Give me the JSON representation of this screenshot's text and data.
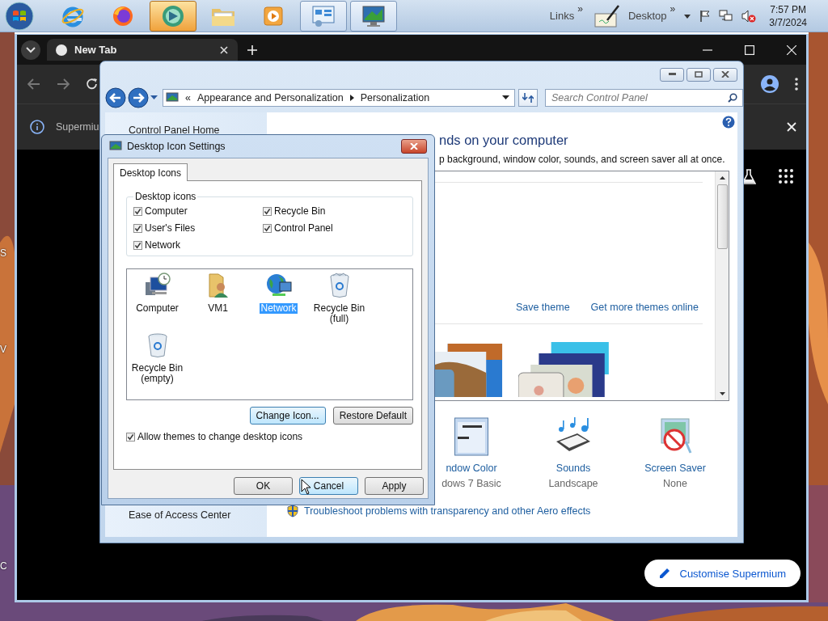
{
  "desktop": {
    "kind": "picture",
    "edge_labels": [
      "S",
      "V",
      "C"
    ]
  },
  "taskbar": {
    "apps": [
      {
        "kind": "ie",
        "selected": false,
        "running": false
      },
      {
        "kind": "firefox",
        "selected": false,
        "running": false
      },
      {
        "kind": "green-app",
        "selected": true,
        "running": false
      },
      {
        "kind": "folder",
        "selected": false,
        "running": false
      },
      {
        "kind": "media",
        "selected": false,
        "running": false
      },
      {
        "kind": "control-panel",
        "selected": false,
        "running": true
      },
      {
        "kind": "display",
        "selected": false,
        "running": true
      }
    ],
    "toolbars": [
      {
        "label": "Links",
        "more": "»"
      },
      {
        "label": "Desktop",
        "more": "»"
      }
    ],
    "volume_muted": true,
    "clock": {
      "time": "7:57 PM",
      "date": "3/7/2024"
    }
  },
  "browser": {
    "tab": {
      "title": "New Tab"
    },
    "infobar": {
      "text": "Supermiu"
    },
    "customise_button": {
      "label": "Customise Supermium"
    }
  },
  "control_panel": {
    "overflow": "«",
    "breadcrumb": [
      "Appearance and Personalization",
      "Personalization"
    ],
    "search": {
      "placeholder": "Search Control Panel"
    },
    "sidebar": [
      {
        "label": "Control Panel Home"
      },
      {
        "label": "Ease of Access Center"
      }
    ],
    "heading": "nds on your computer",
    "subheading": "p background, window color, sounds, and screen saver all at once.",
    "theme_links": [
      "Save theme",
      "Get more themes online"
    ],
    "themes": [
      {
        "kind": "picture"
      },
      {
        "kind": "picture"
      }
    ],
    "settings": [
      {
        "kind": "window-color",
        "label": "ndow Color",
        "value": "dows 7 Basic"
      },
      {
        "kind": "sounds",
        "label": "Sounds",
        "value": "Landscape"
      },
      {
        "kind": "screen-saver",
        "label": "Screen Saver",
        "value": "None"
      }
    ],
    "troubleshoot_link": "Troubleshoot problems with transparency and other Aero effects"
  },
  "dialog": {
    "title": "Desktop Icon Settings",
    "tabs": [
      {
        "label": "Desktop Icons",
        "selected": true
      }
    ],
    "group": {
      "title": "Desktop icons",
      "checkboxes": [
        {
          "label": "Computer",
          "checked": true
        },
        {
          "label": "Recycle Bin",
          "checked": true
        },
        {
          "label": "User's Files",
          "checked": true
        },
        {
          "label": "Control Panel",
          "checked": true
        },
        {
          "label": "Network",
          "checked": true
        }
      ]
    },
    "icons": [
      {
        "kind": "computer",
        "label": "Computer",
        "selected": false
      },
      {
        "kind": "user-folder",
        "label": "VM1",
        "selected": false
      },
      {
        "kind": "network",
        "label": "Network",
        "selected": true
      },
      {
        "kind": "bin-full",
        "label": "Recycle Bin (full)",
        "selected": false
      },
      {
        "kind": "bin-empty",
        "label": "Recycle Bin (empty)",
        "selected": false
      }
    ],
    "icon_buttons": [
      {
        "label": "Change Icon...",
        "focused": true
      },
      {
        "label": "Restore Default",
        "focused": false
      }
    ],
    "allow_themes": {
      "label": "Allow themes to change desktop icons",
      "checked": true
    },
    "buttons": [
      {
        "label": "OK",
        "focused": false
      },
      {
        "label": "Cancel",
        "focused": true
      },
      {
        "label": "Apply",
        "focused": false
      }
    ]
  }
}
